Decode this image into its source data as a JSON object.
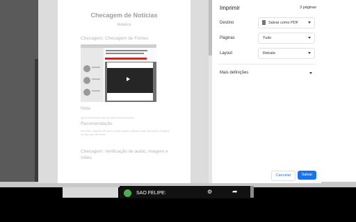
{
  "dialog": {
    "title": "Imprimir",
    "page_count": "3 páginas",
    "destination_label": "Destino",
    "destination_value": "Salvar como PDF",
    "pages_label": "Páginas",
    "pages_value": "Tudo",
    "layout_label": "Layout",
    "layout_value": "Retrato",
    "more_settings": "Mais definições",
    "cancel_label": "Cancelar",
    "save_label": "Salvar"
  },
  "preview": {
    "title": "Checagem de Notícias",
    "subtitle": "Relatório",
    "section1": "Checagem: Checagem de Fontes",
    "note_heading": "Nota",
    "note_text": "agora fontes dizem que as total da sua fotomonst",
    "rec_heading": "Recomendação",
    "rec_text": "bem Web, segunte mês pour e carta orguesir, parentes units discussão a imagens do argo que não existe",
    "section2_line1": "Checagem: Verificação de áudio, imagem e",
    "section2_line2": "vídeo"
  },
  "taskbar": {
    "label": "SAO FELIPE:"
  },
  "icons": {
    "destination": "pdf-file-icon",
    "dropdown": "chevron-down-icon",
    "more": "chevron-down-icon",
    "share": "share-icon",
    "app": "app-icon"
  },
  "colors": {
    "accent": "#1a73e8"
  }
}
